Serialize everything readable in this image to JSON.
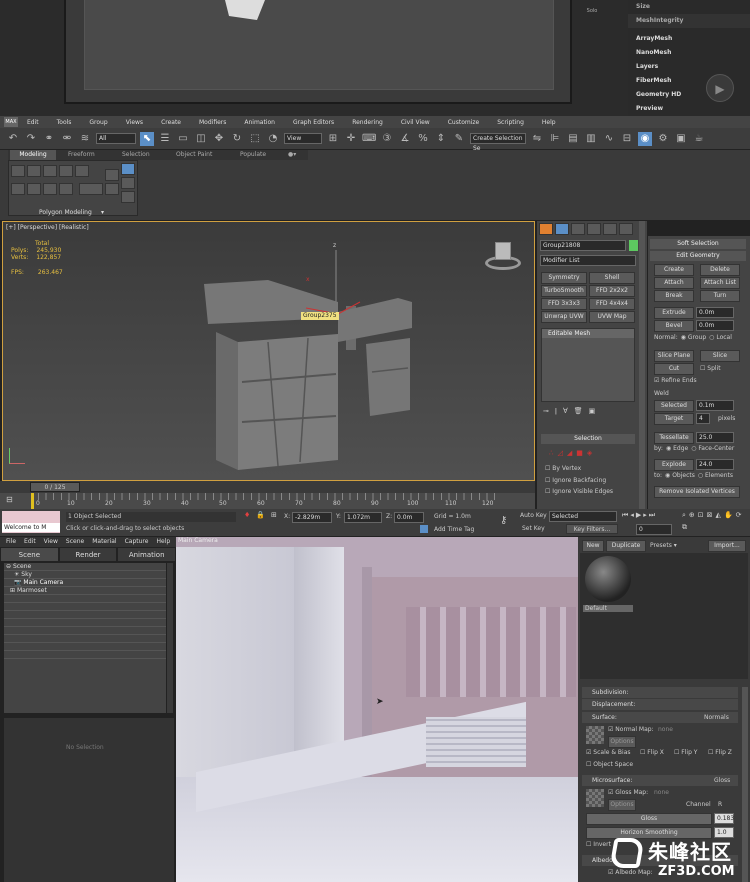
{
  "zbrush": {
    "items": [
      "Size",
      "MeshIntegrity",
      "ArrayMesh",
      "NanoMesh",
      "Layers",
      "FiberMesh",
      "Geometry HD",
      "Preview"
    ],
    "solo_label": "Solo"
  },
  "max": {
    "logo": "MAX",
    "menu": [
      "Edit",
      "Tools",
      "Group",
      "Views",
      "Create",
      "Modifiers",
      "Animation",
      "Graph Editors",
      "Rendering",
      "Civil View",
      "Customize",
      "Scripting",
      "Help"
    ],
    "toolbar": {
      "filter": "All",
      "view": "View",
      "selection_set": "Create Selection Se"
    },
    "ribbon_tabs": [
      "Modeling",
      "Freeform",
      "Selection",
      "Object Paint",
      "Populate"
    ],
    "ribbon_panel": "Polygon Modeling",
    "viewport": {
      "label": "[+] [Perspective] [Realistic]",
      "stats": {
        "total": "Total",
        "polys_label": "Polys:",
        "polys": "245,930",
        "verts_label": "Verts:",
        "verts": "122,857",
        "fps_label": "FPS:",
        "fps": "263.467"
      },
      "tooltip": "Group2375",
      "axis_z": "z",
      "axis_x": "x"
    },
    "command_panel": {
      "object_name": "Group21808",
      "modifier_list": "Modifier List",
      "modifiers": [
        "Symmetry",
        "Shell",
        "TurboSmooth",
        "FFD 2x2x2",
        "FFD 3x3x3",
        "FFD 4x4x4",
        "Unwrap UVW",
        "UVW Map"
      ],
      "stack_item": "Editable Mesh",
      "selection_header": "Selection",
      "by_vertex": "By Vertex",
      "ignore_backfacing": "Ignore Backfacing",
      "ignore_visible_edges": "Ignore Visible Edges"
    },
    "edit_geometry": {
      "soft_selection": "Soft Selection",
      "header": "Edit Geometry",
      "create": "Create",
      "delete": "Delete",
      "attach": "Attach",
      "attach_list": "Attach List",
      "break": "Break",
      "turn": "Turn",
      "extrude": "Extrude",
      "extrude_val": "0.0m",
      "bevel": "Bevel",
      "bevel_val": "0.0m",
      "normal_label": "Normal:",
      "group": "Group",
      "local": "Local",
      "slice_plane": "Slice Plane",
      "slice": "Slice",
      "cut": "Cut",
      "split": "Split",
      "refine_ends": "Refine Ends",
      "weld": "Weld",
      "selected": "Selected",
      "selected_val": "0.1m",
      "target": "Target",
      "target_val": "4",
      "pixels": "pixels",
      "tessellate": "Tessellate",
      "tessellate_val": "25.0",
      "by_label": "by:",
      "edge": "Edge",
      "face_center": "Face-Center",
      "explode": "Explode",
      "explode_val": "24.0",
      "to_label": "to:",
      "objects": "Objects",
      "elements": "Elements",
      "remove_isolated": "Remove Isolated Vertices"
    },
    "timeline": {
      "frame": "0 / 125",
      "ticks": [
        "0",
        "10",
        "20",
        "30",
        "40",
        "50",
        "60",
        "70",
        "80",
        "90",
        "100",
        "110",
        "120"
      ]
    },
    "status": {
      "maxscript": "Welcome to M",
      "selected": "1 Object Selected",
      "prompt": "Click or click-and-drag to select objects",
      "x_label": "X:",
      "x": "-2.829m",
      "y_label": "Y:",
      "y": "1.072m",
      "z_label": "Z:",
      "z": "0.0m",
      "grid": "Grid = 1.0m",
      "add_time_tag": "Add Time Tag",
      "auto_key": "Auto Key",
      "set_key": "Set Key",
      "key_mode": "Selected",
      "key_filters": "Key Filters...",
      "frame_field": "0"
    }
  },
  "marmoset": {
    "menu": [
      "File",
      "Edit",
      "View",
      "Scene",
      "Material",
      "Capture",
      "Help"
    ],
    "tabs": [
      "Scene",
      "Render",
      "Animation"
    ],
    "tree": [
      "Scene",
      "Sky",
      "Main Camera",
      "Marmoset"
    ],
    "no_selection": "No Selection",
    "camera_label": "Main Camera",
    "material": {
      "new": "New",
      "duplicate": "Duplicate",
      "presets": "Presets",
      "import": "Import...",
      "default_name": "Default",
      "subdivision": "Subdivision:",
      "displacement": "Displacement:",
      "surface": "Surface:",
      "surface_mode": "Normals",
      "normal_map": "Normal Map:",
      "none": "none",
      "options": "Options",
      "scale_bias": "Scale & Bias",
      "flip_x": "Flip X",
      "flip_y": "Flip Y",
      "flip_z": "Flip Z",
      "object_space": "Object Space",
      "microsurface": "Microsurface:",
      "microsurface_mode": "Gloss",
      "gloss_map": "Gloss Map:",
      "channel": "Channel",
      "channel_val": "R",
      "gloss": "Gloss",
      "gloss_val": "0.183",
      "horizon_smoothing": "Horizon Smoothing",
      "horizon_val": "1.0",
      "invert": "Invert",
      "albedo": "Albedo:",
      "albedo_map": "Albedo Map:"
    }
  },
  "watermark": {
    "cn": "朱峰社区",
    "url": "ZF3D.COM"
  },
  "colors": {
    "selection_blue": "#5b8fc7",
    "viewport_border": "#d0a040",
    "stats_yellow": "#e8c040"
  }
}
